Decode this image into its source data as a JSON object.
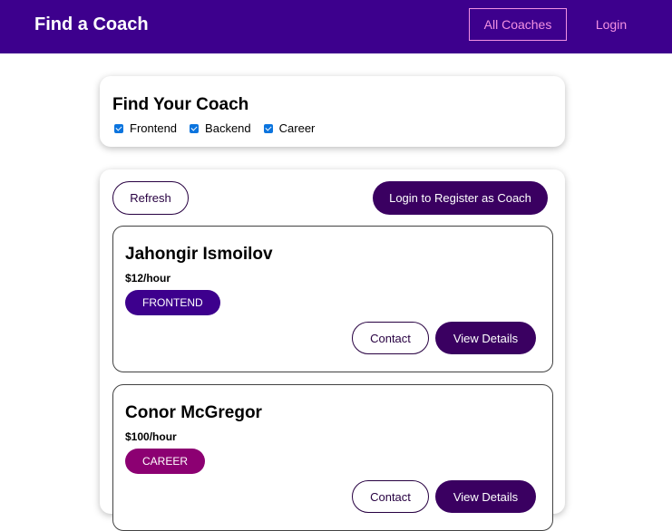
{
  "header": {
    "brand": "Find a Coach",
    "nav": {
      "all_coaches": "All Coaches",
      "login": "Login"
    }
  },
  "filter": {
    "title": "Find Your Coach",
    "options": [
      {
        "label": "Frontend",
        "checked": true
      },
      {
        "label": "Backend",
        "checked": true
      },
      {
        "label": "Career",
        "checked": true
      }
    ]
  },
  "controls": {
    "refresh": "Refresh",
    "register": "Login to Register as Coach"
  },
  "coaches": [
    {
      "name": "Jahongir Ismoilov",
      "rate": "$12/hour",
      "area": "FRONTEND",
      "area_color": "#3d008d",
      "contact": "Contact",
      "details": "View Details"
    },
    {
      "name": "Conor McGregor",
      "rate": "$100/hour",
      "area": "CAREER",
      "area_color": "#8c0072",
      "contact": "Contact",
      "details": "View Details"
    }
  ],
  "colors": {
    "header_bg": "#3d008d",
    "nav_text": "#f391e3",
    "primary_button": "#3a0061",
    "checkbox": "#0b74de"
  }
}
